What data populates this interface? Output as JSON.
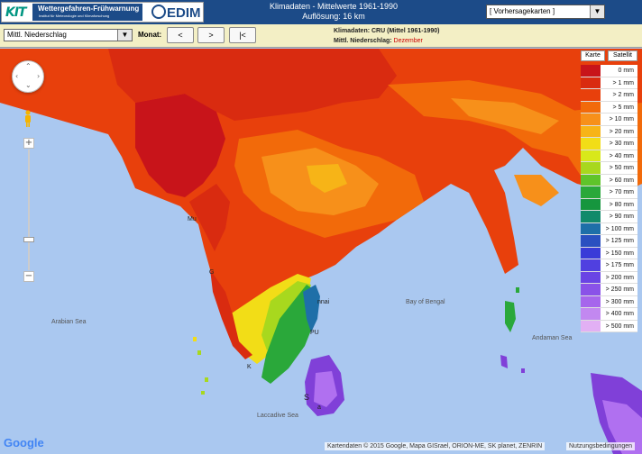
{
  "header": {
    "wf_title": "Wettergefahren-Frühwarnung",
    "wf_subtitle": "Institut für Meteorologie und Klimaforschung",
    "kit_logo": "KIT",
    "cedim_logo": "EDIM",
    "title_line1": "Klimadaten - Mittelwerte 1961-1990",
    "title_line2": "Auflösung: 16 km",
    "forecast_select": "[ Vorhersagekarten ]",
    "forecast_arrow": "▼"
  },
  "toolbar": {
    "parameter_select": "Mittl. Niederschlag",
    "param_arrow": "▼",
    "month_label": "Monat:",
    "btn_prev": "<",
    "btn_next": ">",
    "btn_first": "|<",
    "info_line1": "Klimadaten: CRU (Mittel 1961-1990)",
    "info_line2_label": "Mittl. Niederschlag: ",
    "info_line2_value": "Dezember"
  },
  "map": {
    "sea_labels": [
      "Arabian Sea",
      "Bay of Bengal",
      "Andaman Sea",
      "Laccadive Sea"
    ],
    "city_labels": [
      "Mu",
      "G",
      "nnai",
      "K",
      "PU",
      "S",
      "a"
    ],
    "land_colors": {
      "red": "#d92b10",
      "dark_red": "#c8141a",
      "orange_red": "#e8400c",
      "orange": "#f26a0a",
      "light_orange": "#f7901a",
      "yellow": "#f2dd17",
      "green": "#2aa83a",
      "purple": "#8040d8",
      "violet": "#b070f0"
    }
  },
  "legend": {
    "map_type_map": "Karte",
    "map_type_sat": "Satellit",
    "entries": [
      {
        "label": "0 mm",
        "color": "#c8141a"
      },
      {
        "label": "> 1 mm",
        "color": "#d92b10"
      },
      {
        "label": "> 2 mm",
        "color": "#e8400c"
      },
      {
        "label": "> 5 mm",
        "color": "#f26a0a"
      },
      {
        "label": "> 10 mm",
        "color": "#f7901a"
      },
      {
        "label": "> 20 mm",
        "color": "#f7b417"
      },
      {
        "label": "> 30 mm",
        "color": "#f2dd17"
      },
      {
        "label": "> 40 mm",
        "color": "#d8e81a"
      },
      {
        "label": "> 50 mm",
        "color": "#a8d81e"
      },
      {
        "label": "> 60 mm",
        "color": "#5fc42a"
      },
      {
        "label": "> 70 mm",
        "color": "#2aa83a"
      },
      {
        "label": "> 80 mm",
        "color": "#16963e"
      },
      {
        "label": "> 90 mm",
        "color": "#128a6a"
      },
      {
        "label": "> 100 mm",
        "color": "#1e6fa8"
      },
      {
        "label": "> 125 mm",
        "color": "#2a50c0"
      },
      {
        "label": "> 150 mm",
        "color": "#3a3cd8"
      },
      {
        "label": "> 175 mm",
        "color": "#5040e0"
      },
      {
        "label": "> 200 mm",
        "color": "#6a44e4"
      },
      {
        "label": "> 250 mm",
        "color": "#8a52e8"
      },
      {
        "label": "> 300 mm",
        "color": "#a666ec"
      },
      {
        "label": "> 400 mm",
        "color": "#c288f0"
      },
      {
        "label": "> 500 mm",
        "color": "#e2b0f4"
      }
    ]
  },
  "footer": {
    "google_logo": "Google",
    "attribution": "Kartendaten © 2015 Google, Mapa GISrael, ORION-ME, SK planet, ZENRIN",
    "terms": "Nutzungsbedingungen"
  }
}
